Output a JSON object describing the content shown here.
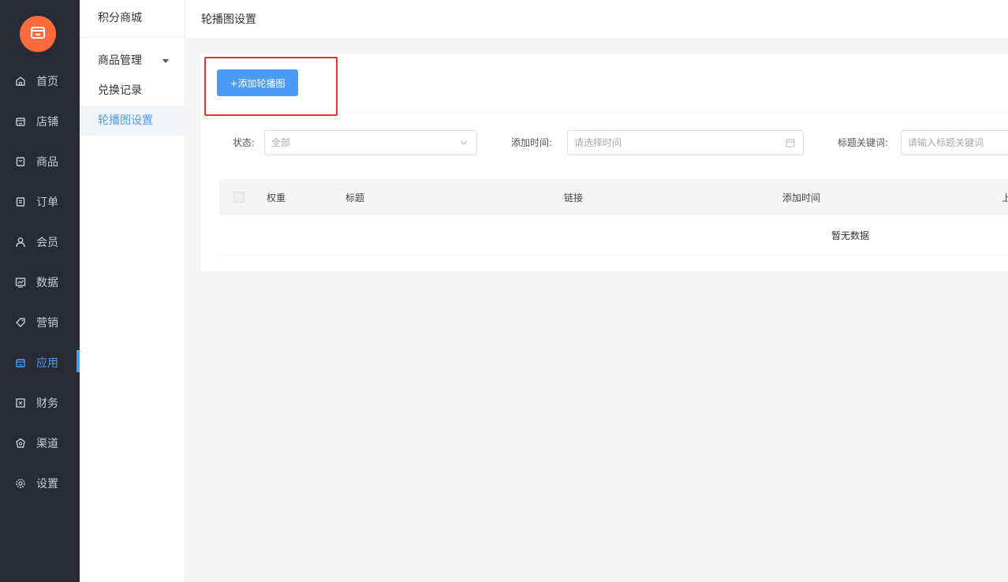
{
  "nav": {
    "items": [
      {
        "label": "首页",
        "icon": "home-icon"
      },
      {
        "label": "店铺",
        "icon": "store-icon"
      },
      {
        "label": "商品",
        "icon": "product-icon"
      },
      {
        "label": "订单",
        "icon": "order-icon"
      },
      {
        "label": "会员",
        "icon": "member-icon"
      },
      {
        "label": "数据",
        "icon": "chart-icon"
      },
      {
        "label": "营销",
        "icon": "tag-icon"
      },
      {
        "label": "应用",
        "icon": "app-icon"
      },
      {
        "label": "财务",
        "icon": "finance-icon"
      },
      {
        "label": "渠道",
        "icon": "channel-icon"
      },
      {
        "label": "设置",
        "icon": "gear-icon"
      }
    ],
    "active_index": 7,
    "accent": "#4a9cf7",
    "logo_color": "#ff6a3d"
  },
  "submenu": {
    "title": "积分商城",
    "items": [
      {
        "label": "商品管理"
      },
      {
        "label": "兑换记录"
      },
      {
        "label": "轮播图设置"
      }
    ]
  },
  "header": {
    "title": "轮播图设置"
  },
  "toolbar": {
    "add_label": "+添加轮播图"
  },
  "filters": {
    "status_label": "状态:",
    "status_value": "全部",
    "time_label": "添加时间:",
    "time_placeholder": "请选择时间",
    "keyword_label": "标题关键词:",
    "keyword_placeholder": "请输入标题关键词"
  },
  "table": {
    "columns": [
      "权重",
      "标题",
      "链接",
      "添加时间",
      "上"
    ],
    "empty_text": "暂无数据"
  }
}
